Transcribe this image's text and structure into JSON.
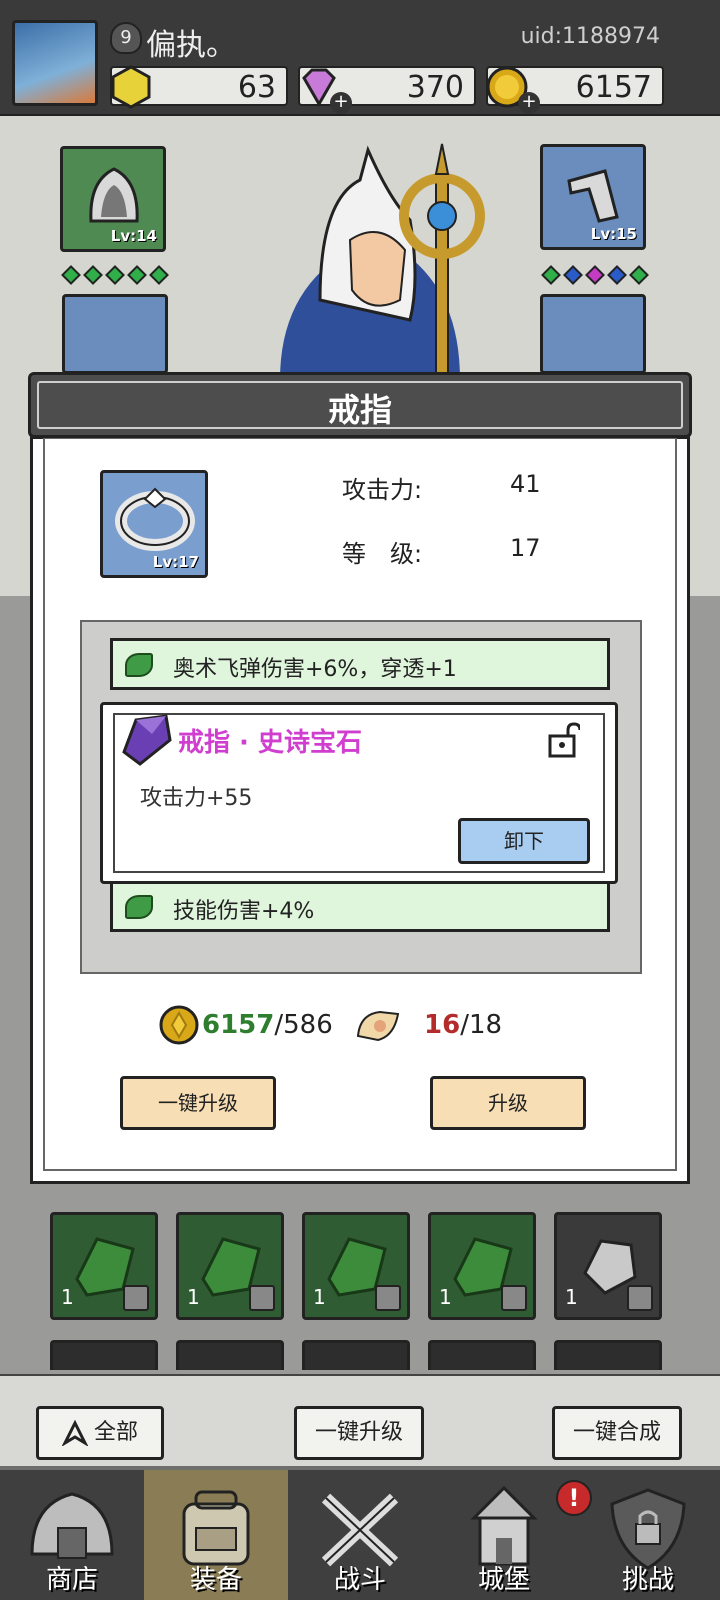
{
  "player": {
    "level": "9",
    "name": "偏执。",
    "uid": "uid:1188974"
  },
  "currencies": [
    {
      "icon": "gold-gem-icon",
      "value": "63"
    },
    {
      "icon": "purple-diamond-icon",
      "value": "370"
    },
    {
      "icon": "gold-coin-icon",
      "value": "6157"
    }
  ],
  "equipment_slots": {
    "helmet": {
      "level": "Lv:14"
    },
    "bracer": {
      "level": "Lv:15"
    }
  },
  "modal": {
    "title": "戒指",
    "item_level_badge": "Lv:17",
    "stats": {
      "attack_label": "攻击力:",
      "attack_value": "41",
      "level_label": "等　级:",
      "level_value": "17"
    },
    "bonuses": [
      "奥术飞弹伤害+6%，穿透+1",
      "技能伤害+4%"
    ],
    "gem": {
      "title": "戒指 · 史诗宝石",
      "stat": "攻击力+55",
      "unequip_label": "卸下"
    },
    "cost": {
      "gold_have": "6157",
      "gold_need": "/586",
      "scroll_have": "16",
      "scroll_need": "/18"
    },
    "one_click_upgrade_label": "一键升级",
    "upgrade_label": "升级"
  },
  "inventory": [
    {
      "count": "1",
      "type": "green"
    },
    {
      "count": "1",
      "type": "green"
    },
    {
      "count": "1",
      "type": "green"
    },
    {
      "count": "1",
      "type": "green"
    },
    {
      "count": "1",
      "type": "grey"
    }
  ],
  "toolbar": {
    "all_label": "全部",
    "one_click_upgrade_label": "一键升级",
    "one_click_merge_label": "一键合成"
  },
  "nav": {
    "shop": "商店",
    "equip": "装备",
    "battle": "战斗",
    "castle": "城堡",
    "challenge": "挑战",
    "notification": "!"
  },
  "colors": {
    "gem_title": "#d03ed0",
    "gold_have": "#2f7d2f",
    "scroll_have": "#b32b2b"
  }
}
